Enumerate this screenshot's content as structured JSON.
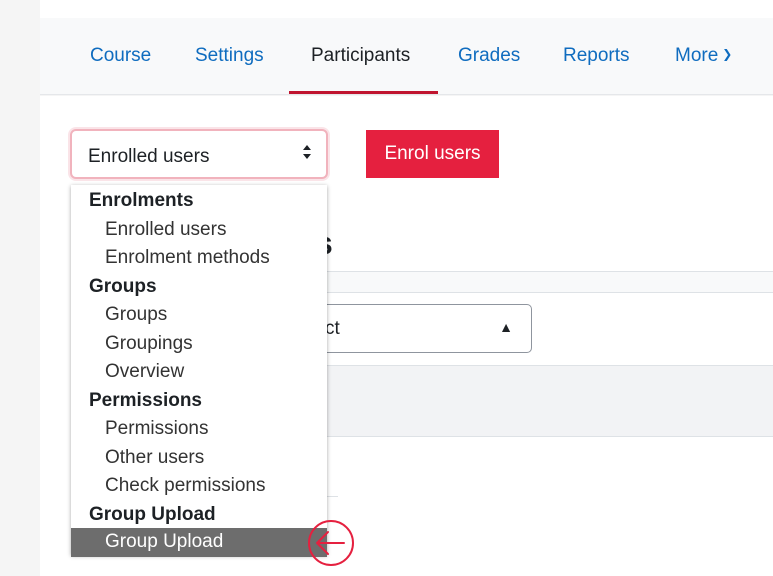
{
  "nav": {
    "tabs": [
      {
        "label": "Course"
      },
      {
        "label": "Settings"
      },
      {
        "label": "Participants"
      },
      {
        "label": "Grades"
      },
      {
        "label": "Reports"
      },
      {
        "label": "More"
      }
    ],
    "active_tab": "Participants",
    "more_icon": "chevron-down-icon"
  },
  "selector": {
    "value": "Enrolled users",
    "icon": "sort-arrows-icon"
  },
  "enrol_button": {
    "label": "Enrol users"
  },
  "background": {
    "heading_fragment": "s",
    "select_fragment": "ct"
  },
  "dropdown": {
    "groups": [
      {
        "label": "Enrolments",
        "options": [
          {
            "label": "Enrolled users"
          },
          {
            "label": "Enrolment methods"
          }
        ]
      },
      {
        "label": "Groups",
        "options": [
          {
            "label": "Groups"
          },
          {
            "label": "Groupings"
          },
          {
            "label": "Overview"
          }
        ]
      },
      {
        "label": "Permissions",
        "options": [
          {
            "label": "Permissions"
          },
          {
            "label": "Other users"
          },
          {
            "label": "Check permissions"
          }
        ]
      },
      {
        "label": "Group Upload",
        "options": [
          {
            "label": "Group Upload"
          }
        ]
      }
    ],
    "highlighted_option": "Group Upload"
  },
  "annotation": {
    "icon": "arrow-left-circle-icon",
    "color": "#e5203f"
  },
  "colors": {
    "accent": "#e5203f",
    "link": "#0f6cbf",
    "active_underline": "#c0152f",
    "highlight": "#6d6d6d"
  }
}
